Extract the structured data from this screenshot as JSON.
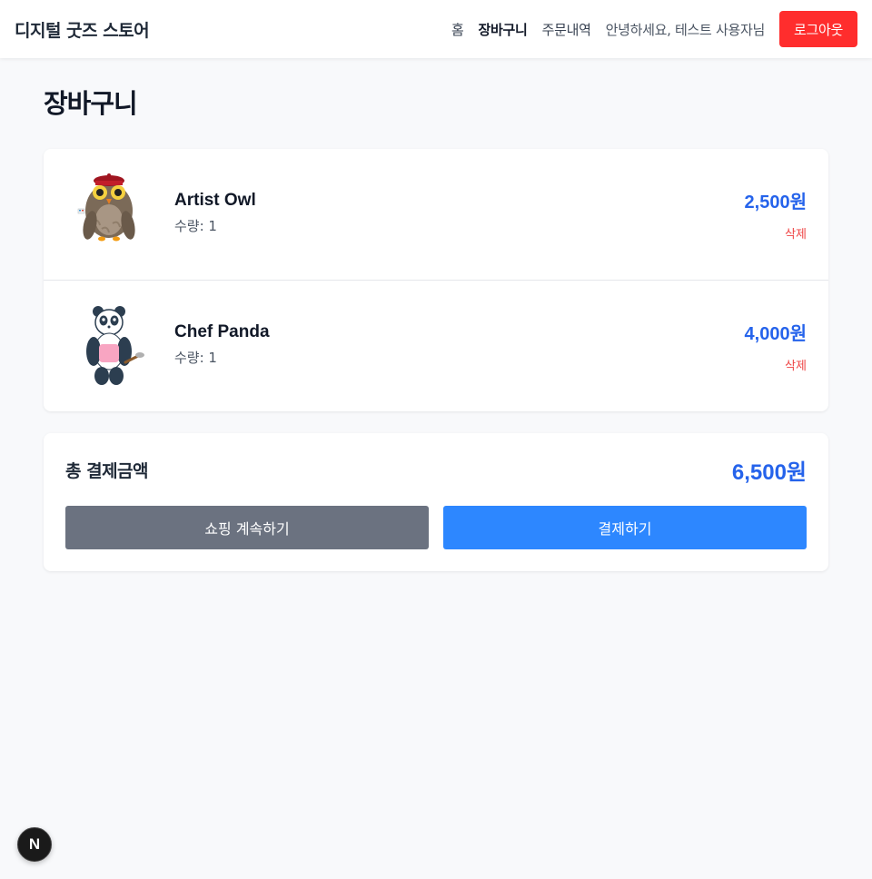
{
  "header": {
    "brand": "디지털 굿즈 스토어",
    "nav": {
      "home": "홈",
      "cart": "장바구니",
      "orders": "주문내역",
      "greeting": "안녕하세요, 테스트 사용자님",
      "logout": "로그아웃"
    }
  },
  "page": {
    "title": "장바구니"
  },
  "cart": {
    "items": [
      {
        "name": "Artist Owl",
        "qty_text": "수량: 1",
        "price": "2,500원",
        "delete_label": "삭제",
        "icon": "owl-icon"
      },
      {
        "name": "Chef Panda",
        "qty_text": "수량: 1",
        "price": "4,000원",
        "delete_label": "삭제",
        "icon": "panda-icon"
      }
    ]
  },
  "summary": {
    "label": "총 결제금액",
    "total": "6,500원",
    "continue_label": "쇼핑 계속하기",
    "checkout_label": "결제하기"
  },
  "dev_badge": {
    "letter": "N"
  },
  "colors": {
    "accent": "#2563eb",
    "checkout_button": "#2d87ff",
    "logout_button": "#ff2d2d",
    "delete_text": "#ef4444",
    "continue_button": "#6b7280"
  }
}
